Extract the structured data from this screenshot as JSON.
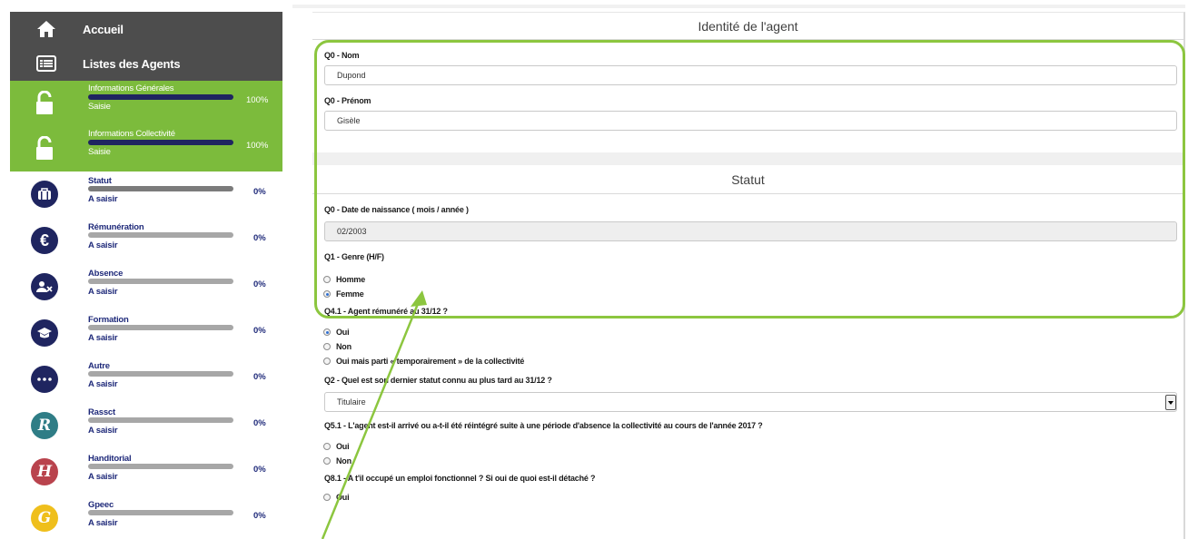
{
  "nav": {
    "home": "Accueil",
    "agents": "Listes des Agents"
  },
  "sections": [
    {
      "title": "Informations Générales",
      "status": "Saisie",
      "percent": "100%",
      "progress": 1.0,
      "icon": "unlock-icon",
      "color": "#7cbb3c"
    },
    {
      "title": "Informations Collectivité",
      "status": "Saisie",
      "percent": "100%",
      "progress": 1.0,
      "icon": "unlock-icon",
      "color": "#7cbb3c"
    },
    {
      "title": "Statut",
      "status": "A saisir",
      "percent": "0%",
      "progress": 0.0,
      "icon": "briefcase-icon",
      "color": "#1f2560"
    },
    {
      "title": "Rémunération",
      "status": "A saisir",
      "percent": "0%",
      "progress": 0.0,
      "icon": "euro-icon",
      "color": "#1f2560"
    },
    {
      "title": "Absence",
      "status": "A saisir",
      "percent": "0%",
      "progress": 0.0,
      "icon": "user-remove-icon",
      "color": "#1f2560"
    },
    {
      "title": "Formation",
      "status": "A saisir",
      "percent": "0%",
      "progress": 0.0,
      "icon": "graduation-cap-icon",
      "color": "#1f2560"
    },
    {
      "title": "Autre",
      "status": "A saisir",
      "percent": "0%",
      "progress": 0.0,
      "icon": "more-icon",
      "color": "#1f2560"
    },
    {
      "title": "Rassct",
      "status": "A saisir",
      "percent": "0%",
      "progress": 0.0,
      "icon": "r-letter-icon",
      "color": "#2f7d86"
    },
    {
      "title": "Handitorial",
      "status": "A saisir",
      "percent": "0%",
      "progress": 0.0,
      "icon": "h-letter-icon",
      "color": "#b9434d"
    },
    {
      "title": "Gpeec",
      "status": "A saisir",
      "percent": "0%",
      "progress": 0.0,
      "icon": "g-letter-icon",
      "color": "#efbf1c"
    }
  ],
  "identity": {
    "heading": "Identité de l'agent",
    "nom_label": "Q0 - Nom",
    "nom_value": "Dupond",
    "prenom_label": "Q0 - Prénom",
    "prenom_value": "Gisèle"
  },
  "statut": {
    "heading": "Statut",
    "dob_label": "Q0 - Date de naissance ( mois / année )",
    "dob_value": "02/2003",
    "genre_label": "Q1 - Genre (H/F)",
    "genre_options": [
      "Homme",
      "Femme"
    ],
    "genre_selected": "Femme",
    "remun_label": "Q4.1 - Agent rémunéré au 31/12 ?",
    "remun_options": [
      "Oui",
      "Non",
      "Oui mais parti « temporairement » de la collectivité"
    ],
    "remun_selected": "Oui",
    "statut_label": "Q2 - Quel est son dernier statut connu au plus tard au 31/12 ?",
    "statut_value": "Titulaire",
    "arrive_label": "Q5.1 - L'agent est-il arrivé ou a-t-il été réintégré suite à une période d'absence la collectivité au cours de l'année 2017 ?",
    "arrive_options": [
      "Oui",
      "Non"
    ],
    "emploi_label": "Q8.1 - A t'il occupé un emploi fonctionnel ? Si oui de quoi est-il détaché ?",
    "emploi_options": [
      "Oui"
    ]
  }
}
